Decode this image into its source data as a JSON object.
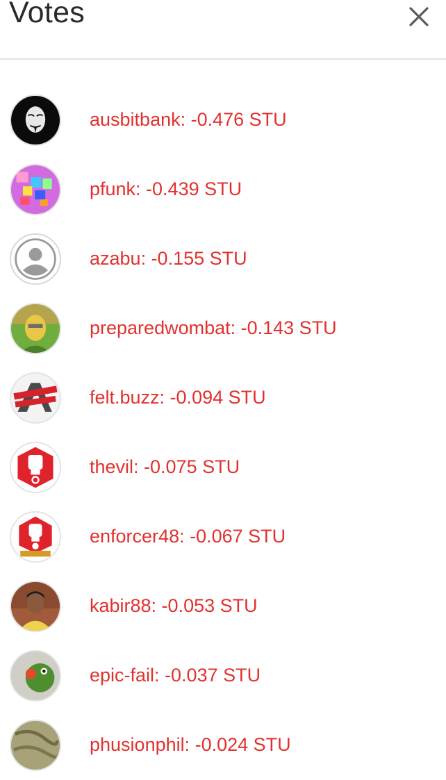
{
  "header": {
    "title": "Votes",
    "close_icon": "close-icon"
  },
  "accent_color": "#e2312d",
  "votes": [
    {
      "label": "ausbitbank: -0.476 STU",
      "avatar": "avatar-mask"
    },
    {
      "label": "pfunk: -0.439 STU",
      "avatar": "avatar-colorful"
    },
    {
      "label": "azabu: -0.155 STU",
      "avatar": "avatar-default-user"
    },
    {
      "label": "preparedwombat: -0.143 STU",
      "avatar": "avatar-photo"
    },
    {
      "label": "felt.buzz: -0.094 STU",
      "avatar": "avatar-censored-logo"
    },
    {
      "label": "thevil: -0.075 STU",
      "avatar": "avatar-revolution-fist"
    },
    {
      "label": "enforcer48: -0.067 STU",
      "avatar": "avatar-revolutionary-fist"
    },
    {
      "label": "kabir88: -0.053 STU",
      "avatar": "avatar-photo"
    },
    {
      "label": "epic-fail: -0.037 STU",
      "avatar": "avatar-frog"
    },
    {
      "label": "phusionphil: -0.024 STU",
      "avatar": "avatar-photo"
    }
  ]
}
